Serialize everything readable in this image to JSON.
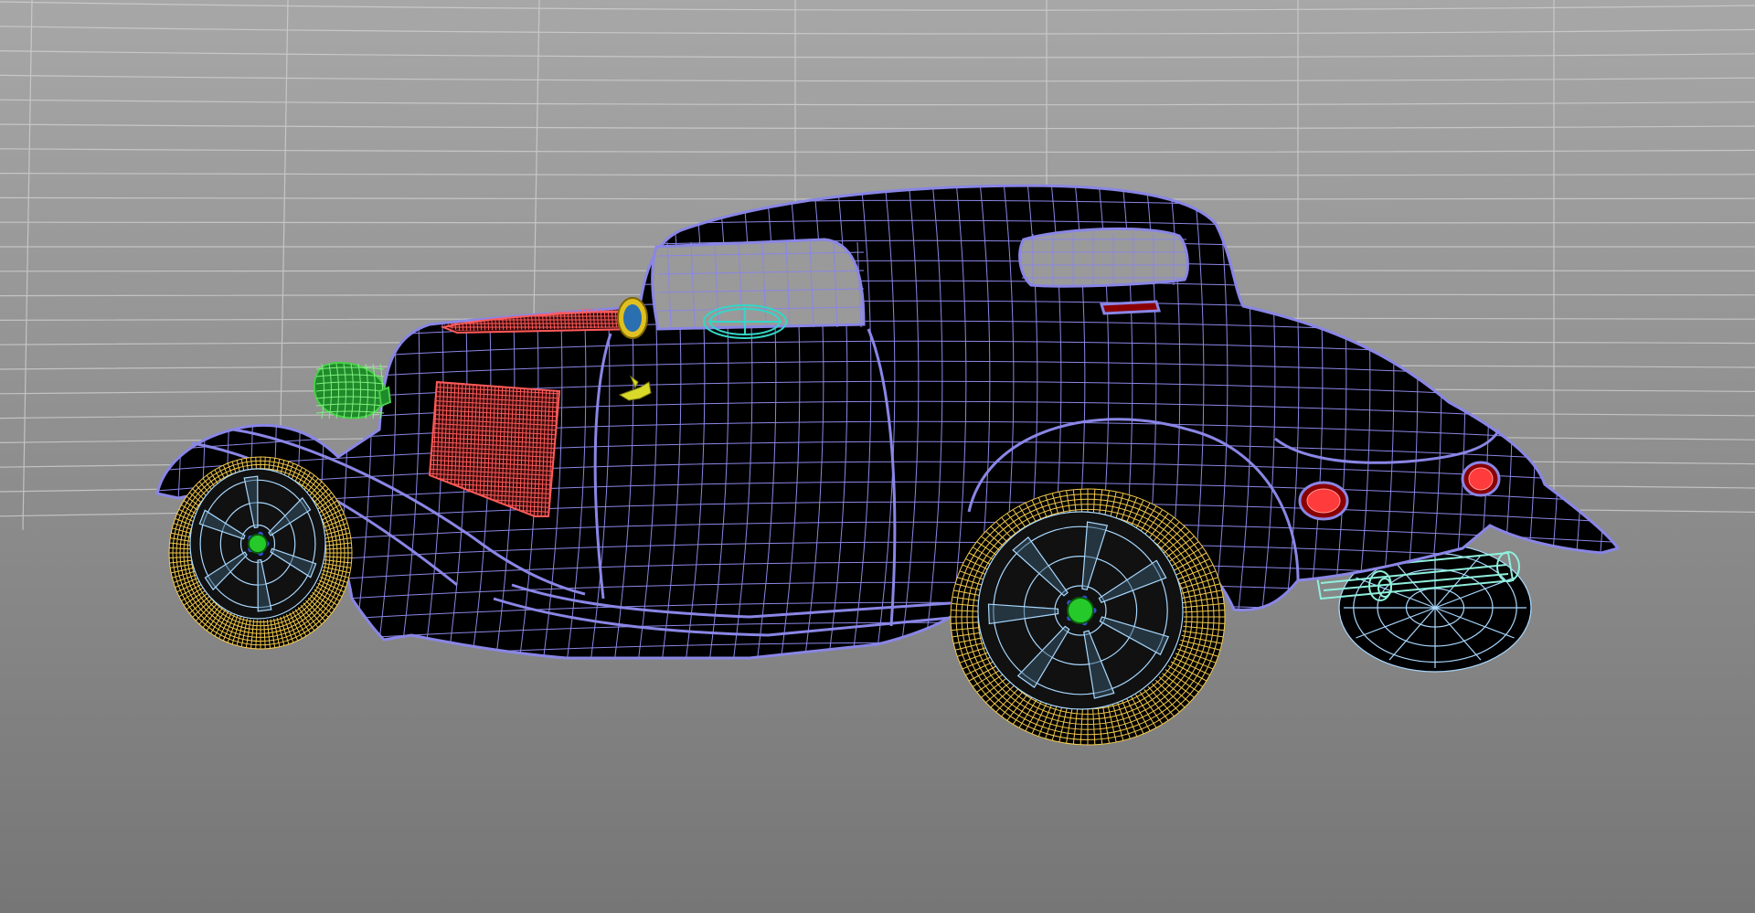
{
  "viewport": {
    "background_top": "#a7a7a7",
    "background_bottom": "#767676",
    "grid_color": "#d4d4d4"
  },
  "model": {
    "colors": {
      "body_fill": "#000000",
      "body_wire": "#8a86e6",
      "grille_wire": "#ff5a5a",
      "tire_wire": "#f2c94c",
      "rim_wire": "#a8d8ff",
      "headlight_fill": "#1f8a2a",
      "hub_green": "#26c92a",
      "interior_teal": "#34d6c6",
      "exhaust_wire": "#8ff0dc",
      "ornament_yellow": "#d9d92a",
      "mirror_yellow": "#e0c020",
      "mirror_blue": "#2a6fb0",
      "taillight_red": "#ff3b3b"
    }
  }
}
